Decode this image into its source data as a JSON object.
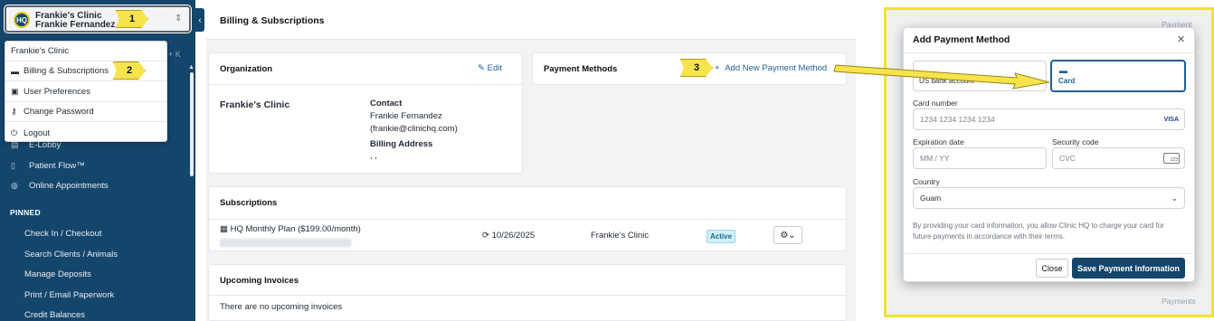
{
  "org_switcher": {
    "logo_text": "HQ",
    "org_name": "Frankie's Clinic",
    "user_name": "Frankie Fernandez"
  },
  "sidebar": {
    "kbd_hint": "+ K",
    "items": [
      {
        "label": "E-Lobby",
        "icon": "monitor-icon"
      },
      {
        "label": "Patient Flow™",
        "icon": "document-icon"
      },
      {
        "label": "Online Appointments",
        "icon": "globe-icon"
      }
    ],
    "pinned_heading": "PINNED",
    "pinned": [
      "Check In / Checkout",
      "Search Clients / Animals",
      "Manage Deposits",
      "Print / Email Paperwork",
      "Credit Balances"
    ]
  },
  "menu": {
    "items": [
      {
        "label": "Frankie's Clinic",
        "icon": ""
      },
      {
        "label": "Billing & Subscriptions",
        "icon": "credit-card-icon"
      },
      {
        "label": "User Preferences",
        "icon": "id-card-icon"
      },
      {
        "label": "Change Password",
        "icon": "key-icon"
      },
      {
        "label": "Logout",
        "icon": "power-icon"
      }
    ]
  },
  "page": {
    "title": "Billing & Subscriptions"
  },
  "organization": {
    "heading": "Organization",
    "edit_label": "Edit",
    "name": "Frankie's Clinic",
    "contact_label": "Contact",
    "contact_name": "Frankie Fernandez",
    "contact_email": "(frankie@clinichq.com)",
    "billing_label": "Billing Address",
    "billing_value": ", ,"
  },
  "payment_methods": {
    "heading": "Payment Methods",
    "add_label": "Add New Payment Method"
  },
  "subscriptions": {
    "heading": "Subscriptions",
    "rows": [
      {
        "plan": "HQ Monthly Plan ($199.00/month)",
        "renewal": "10/26/2025",
        "clinic": "Frankie's Clinic",
        "status": "Active"
      }
    ]
  },
  "invoices": {
    "heading": "Upcoming Invoices",
    "empty_text": "There are no upcoming invoices"
  },
  "callouts": {
    "one": "1",
    "two": "2",
    "three": "3"
  },
  "background": {
    "top_text": "Payment Metho",
    "bottom_text": "Payments"
  },
  "modal": {
    "title": "Add Payment Method",
    "options": {
      "bank_label": "US bank account",
      "card_label": "Card",
      "selected": "Card"
    },
    "card_number_label": "Card number",
    "card_number_placeholder": "1234 1234 1234 1234",
    "card_brand": "VISA",
    "expiry_label": "Expiration date",
    "expiry_placeholder": "MM / YY",
    "cvc_label": "Security code",
    "cvc_placeholder": "CVC",
    "cvc_badge": "123",
    "country_label": "Country",
    "country_value": "Guam",
    "consent": "By providing your card information, you allow Clinic HQ to charge your card for future payments in accordance with their terms.",
    "close_label": "Close",
    "save_label": "Save Payment Information"
  },
  "colors": {
    "sidebar": "#14456b",
    "accent": "#1f5f93",
    "callout": "#f7e34c",
    "badge": "#cfeffb"
  }
}
